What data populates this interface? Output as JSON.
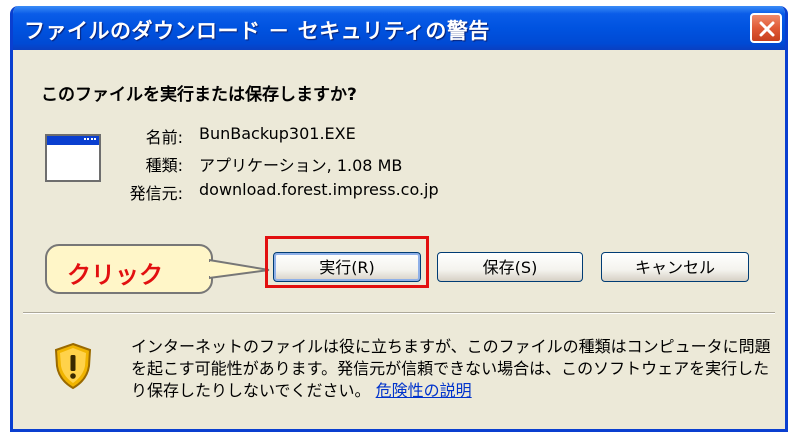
{
  "window": {
    "title": "ファイルのダウンロード － セキュリティの警告"
  },
  "question": "このファイルを実行または保存しますか?",
  "file": {
    "rows": [
      {
        "label": "名前:",
        "value": "BunBackup301.EXE"
      },
      {
        "label": "種類:",
        "value": "アプリケーション, 1.08 MB"
      },
      {
        "label": "発信元:",
        "value": "download.forest.impress.co.jp"
      }
    ]
  },
  "buttons": {
    "run": "実行(R)",
    "save": "保存(S)",
    "cancel": "キャンセル"
  },
  "callout": {
    "text": "クリック"
  },
  "warning": {
    "text": "インターネットのファイルは役に立ちますが、このファイルの種類はコンピュータに問題を起こす可能性があります。発信元が信頼できない場合は、このソフトウェアを実行したり保存したりしないでください。",
    "link": "危険性の説明"
  },
  "colors": {
    "titlebar": "#0053e0",
    "close_button": "#e05a36",
    "highlight": "#e21010",
    "link": "#0033cc"
  },
  "icons": {
    "file": "application-window-icon",
    "warning": "security-shield-icon",
    "close": "close-icon"
  }
}
